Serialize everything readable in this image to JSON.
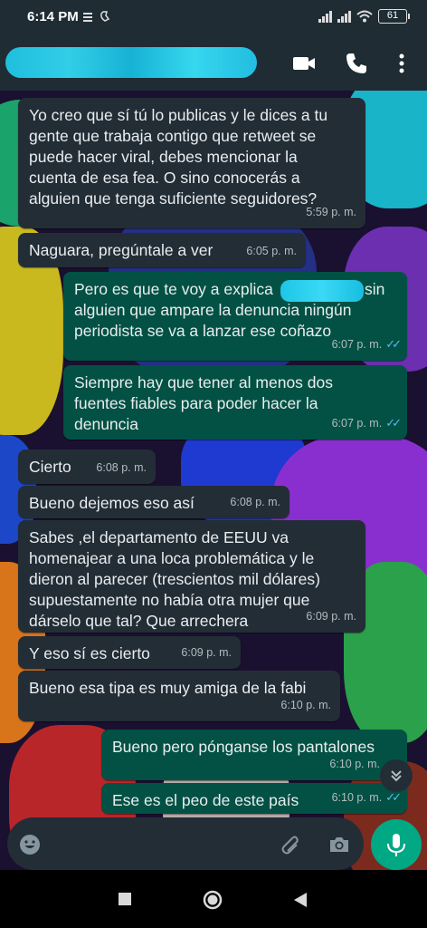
{
  "status_bar": {
    "time": "6:14 PM",
    "battery": "61"
  },
  "contact": {
    "name_redacted": true
  },
  "composer": {
    "placeholder": ""
  },
  "messages": [
    {
      "dir": "in",
      "lines": [
        "Yo creo que sí tú lo publicas y le dices a tu",
        "gente que trabaja contigo que retweet se",
        "puede hacer viral, debes mencionar la",
        "cuenta de  esa fea. O sino conocerás a",
        "alguien que tenga suficiente seguidores?"
      ],
      "time": "5:59 p. m."
    },
    {
      "dir": "in",
      "lines": [
        "Naguara, pregúntale a ver"
      ],
      "time": "6:05 p. m."
    },
    {
      "dir": "out",
      "lines": [
        "Pero es que te voy a explica",
        "alguien que ampare la denuncia ningún",
        "periodista se va a lanzar ese coñazo"
      ],
      "line1_tail": "sin",
      "time": "6:07 p. m.",
      "read": true
    },
    {
      "dir": "out",
      "lines": [
        "Siempre hay que tener al menos dos",
        "fuentes fiables para poder hacer la",
        "denuncia"
      ],
      "time": "6:07 p. m.",
      "read": true
    },
    {
      "dir": "in",
      "lines": [
        "Cierto"
      ],
      "time": "6:08 p. m."
    },
    {
      "dir": "in",
      "lines": [
        "Bueno dejemos eso así"
      ],
      "time": "6:08 p. m."
    },
    {
      "dir": "in",
      "lines": [
        "Sabes ,el departamento de EEUU va",
        "homenajear a una loca problemática y le",
        "dieron al parecer (trescientos mil dólares)",
        "supuestamente no había otra mujer que",
        "dárselo que tal? Que arrechera"
      ],
      "time": "6:09 p. m."
    },
    {
      "dir": "in",
      "lines": [
        "Y eso sí es cierto"
      ],
      "time": "6:09 p. m."
    },
    {
      "dir": "in",
      "lines": [
        "Bueno esa tipa es muy amiga de la fabi"
      ],
      "time": "6:10 p. m."
    },
    {
      "dir": "out",
      "lines": [
        "Bueno pero pónganse los pantalones"
      ],
      "time": "6:10 p. m.",
      "read": false
    },
    {
      "dir": "out",
      "lines": [
        "Ese es el peo de este país"
      ],
      "time": "6:10 p. m.",
      "read": true
    }
  ],
  "colors": {
    "header": "#1f2c34",
    "incoming_bubble": "#232d36",
    "outgoing_bubble": "#025144",
    "accent": "#00a884",
    "read_tick": "#53bdeb"
  }
}
